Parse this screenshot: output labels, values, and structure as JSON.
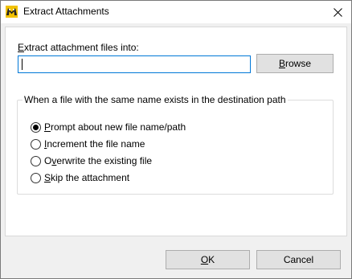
{
  "window": {
    "title": "Extract Attachments",
    "icon": "app-icon",
    "close_icon": "close-icon"
  },
  "extract": {
    "label_pre": "",
    "label_mnemonic": "E",
    "label_post": "xtract attachment files into:",
    "path_value": ""
  },
  "browse": {
    "pre": "",
    "mnemonic": "B",
    "post": "rowse"
  },
  "conflict_group": {
    "title": "When a file with the same name exists in the destination path",
    "selected_index": 0,
    "options": [
      {
        "pre": "",
        "mnemonic": "P",
        "post": "rompt about new file name/path"
      },
      {
        "pre": "",
        "mnemonic": "I",
        "post": "ncrement the file name"
      },
      {
        "pre": "O",
        "mnemonic": "v",
        "post": "erwrite the existing file"
      },
      {
        "pre": "",
        "mnemonic": "S",
        "post": "kip the attachment"
      }
    ]
  },
  "footer": {
    "ok": {
      "pre": "",
      "mnemonic": "O",
      "post": "K"
    },
    "cancel": {
      "pre": "Cancel",
      "mnemonic": "",
      "post": ""
    }
  },
  "colors": {
    "focus_border": "#0078d7",
    "button_face": "#e1e1e1",
    "dialog_bg": "#f0f0f0"
  }
}
